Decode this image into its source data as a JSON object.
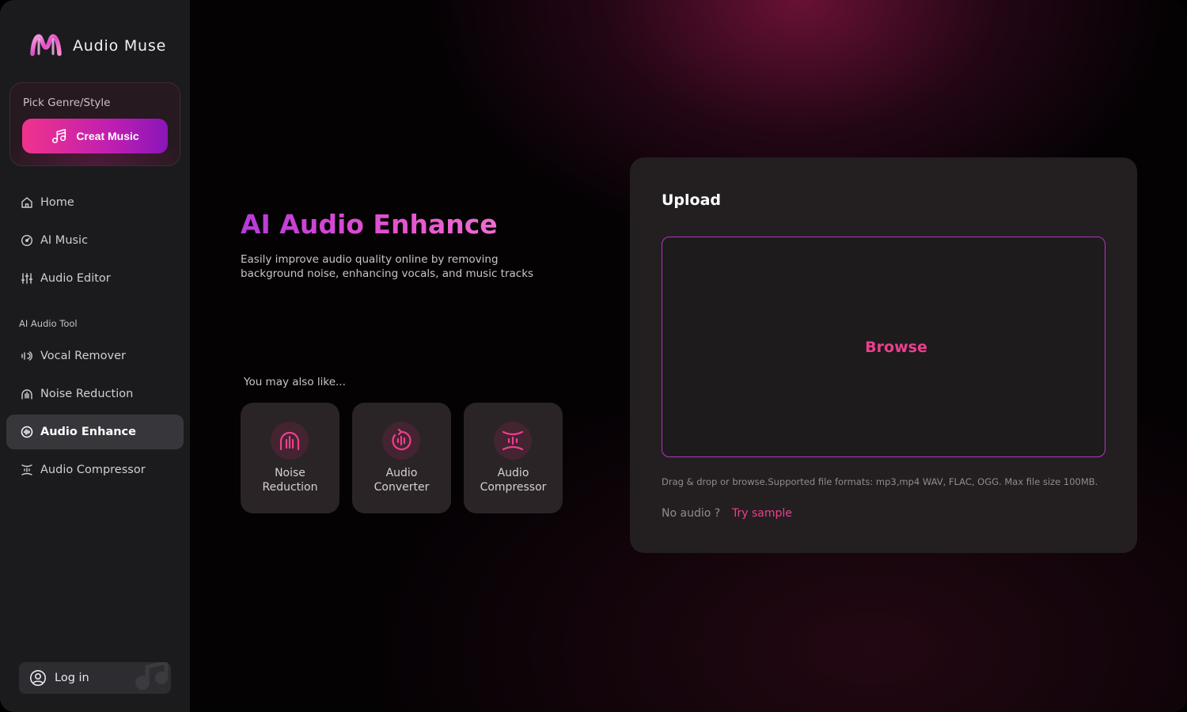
{
  "brand": {
    "name": "Audio Muse",
    "logo_icon": "m-wave-logo"
  },
  "genre_card": {
    "label": "Pick Genre/Style",
    "button_label": "Creat Music",
    "button_icon": "music-note-icon"
  },
  "nav": {
    "items": [
      {
        "label": "Home",
        "icon": "home-icon",
        "active": false
      },
      {
        "label": "AI Music",
        "icon": "disc-icon",
        "active": false
      },
      {
        "label": "Audio Editor",
        "icon": "sliders-icon",
        "active": false
      }
    ],
    "section_title": "AI Audio Tool",
    "tools": [
      {
        "label": "Vocal Remover",
        "icon": "vocal-remover-icon",
        "active": false
      },
      {
        "label": "Noise Reduction",
        "icon": "noise-reduction-icon",
        "active": false
      },
      {
        "label": "Audio Enhance",
        "icon": "audio-enhance-icon",
        "active": true
      },
      {
        "label": "Audio Compressor",
        "icon": "audio-compressor-icon",
        "active": false
      }
    ]
  },
  "login": {
    "label": "Log in",
    "icon": "user-circle-icon"
  },
  "hero": {
    "title": "AI Audio Enhance",
    "description": "Easily improve audio quality online by removing background noise, enhancing vocals, and music tracks"
  },
  "also_like": {
    "label": "You may also like...",
    "cards": [
      {
        "line1": "Noise",
        "line2": "Reduction",
        "icon": "noise-reduction-icon"
      },
      {
        "line1": "Audio",
        "line2": "Converter",
        "icon": "audio-converter-icon"
      },
      {
        "line1": "Audio",
        "line2": "Compressor",
        "icon": "audio-compressor-icon"
      }
    ]
  },
  "upload": {
    "title": "Upload",
    "browse_label": "Browse",
    "formats_text": "Drag & drop  or browse.Supported file formats: mp3,mp4 WAV, FLAC, OGG. Max file size 100MB.",
    "no_audio_label": "No audio ?",
    "try_sample_label": "Try sample"
  },
  "colors": {
    "accent_pink": "#ee3e8f",
    "accent_purple": "#b533c4",
    "sidebar_bg": "#1b1b1d"
  }
}
